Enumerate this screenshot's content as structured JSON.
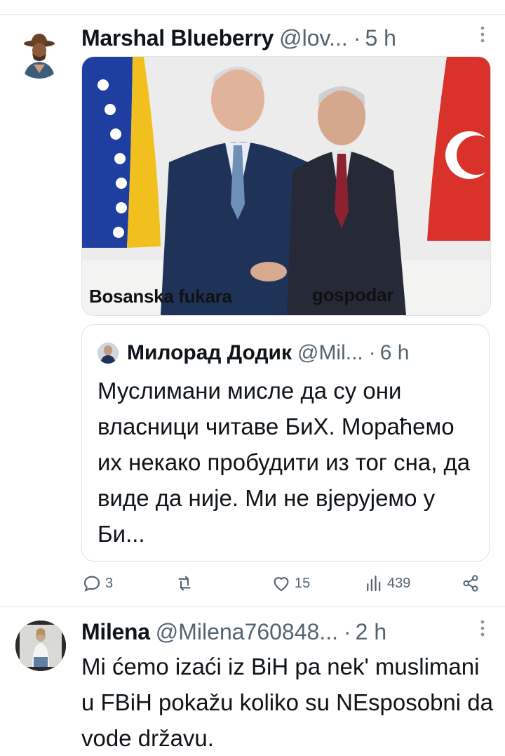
{
  "tweets": [
    {
      "author_name": "Marshal Blueberry",
      "handle": "@lov...",
      "separator": "·",
      "time": "5 h",
      "image_captions": {
        "left": "Bosanska fukara",
        "right": "gospodar"
      },
      "quoted": {
        "author_name": "Милорад Додик",
        "handle": "@Mil...",
        "separator": "·",
        "time": "6 h",
        "text": "Муслимани мисле да су они власници читаве БиХ. Мораћемо их некако пробудити из тог сна, да виде да није. Ми не вјерујемо у Би..."
      },
      "actions": {
        "replies": "3",
        "retweets": "",
        "likes": "15",
        "views": "439"
      }
    },
    {
      "author_name": "Milena",
      "handle": "@Milena760848...",
      "separator": "·",
      "time": "2 h",
      "text": "Mi ćemo izaći iz BiH pa nek' muslimani u FBiH pokažu koliko su NEsposobni da vode državu."
    }
  ],
  "icons": [
    "reply-icon",
    "retweet-icon",
    "like-icon",
    "views-icon",
    "share-icon",
    "more-icon"
  ],
  "colors": {
    "text": "#0f1419",
    "secondary": "#536471",
    "divider": "#e6e8ea"
  }
}
